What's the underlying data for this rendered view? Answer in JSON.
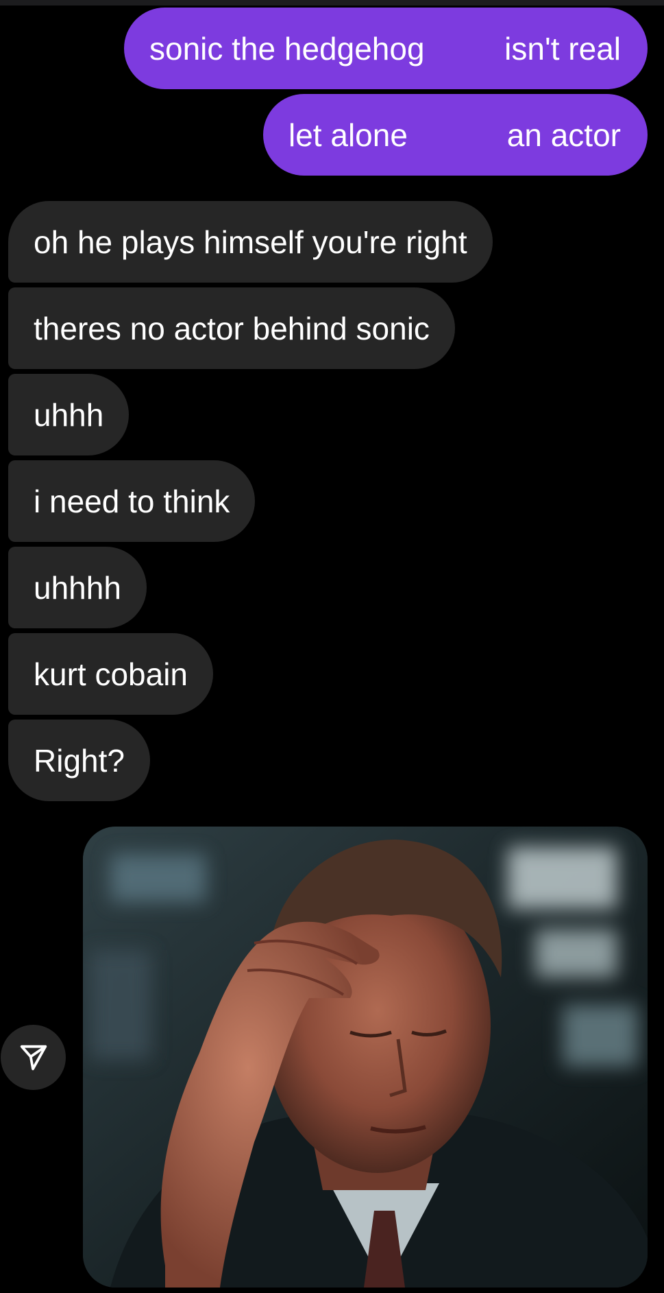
{
  "messages": {
    "sent": [
      {
        "left": "sonic the hedgehog",
        "right": "isn't real"
      },
      {
        "left": "let alone",
        "right": "an actor"
      }
    ],
    "received": [
      "oh he plays himself you're right",
      "theres no actor behind sonic",
      "uhhh",
      "i need to think",
      "uhhhh",
      "kurt cobain",
      "Right?"
    ]
  },
  "media": {
    "icon": "paper-plane-share-icon",
    "gif_subject": "man-facepalm-gif"
  },
  "colors": {
    "background": "#000000",
    "sent_bubble": "#7d3bdf",
    "received_bubble": "#262626",
    "text": "#ffffff"
  }
}
